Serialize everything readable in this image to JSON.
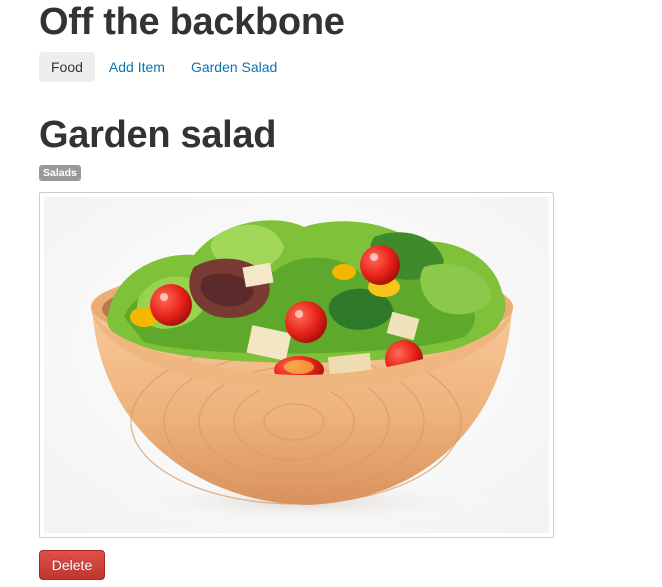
{
  "app": {
    "title": "Off the backbone"
  },
  "nav": {
    "items": [
      {
        "label": "Food",
        "active": true
      },
      {
        "label": "Add Item",
        "active": false
      },
      {
        "label": "Garden Salad",
        "active": false
      }
    ]
  },
  "item": {
    "title": "Garden salad",
    "category": "Salads",
    "image_subject": "salad-bowl",
    "delete_label": "Delete"
  },
  "colors": {
    "link": "#0a75b5",
    "heading": "#333333",
    "badge": "#999999",
    "danger": "#bd362f"
  }
}
